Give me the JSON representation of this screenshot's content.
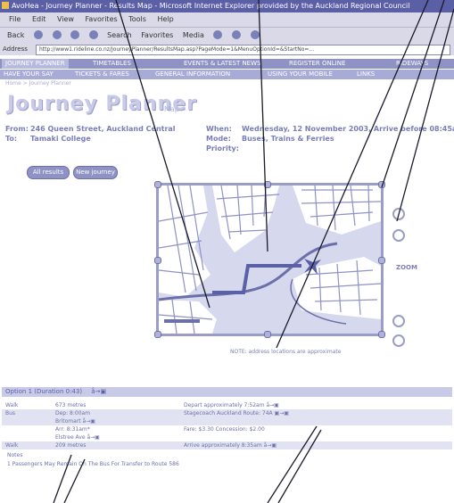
{
  "window": {
    "title": "AvoHea - Journey Planner - Results Map - Microsoft Internet Explorer provided by the Auckland Regional Council",
    "menu": [
      "File",
      "Edit",
      "View",
      "Favorites",
      "Tools",
      "Help"
    ],
    "toolbar": [
      "Back",
      "Search",
      "Favorites",
      "Media"
    ],
    "address_label": "Address",
    "url": "http://www1.rideline.co.nz/JourneyPlanner/ResultsMap.asp?PageMode=1&MenuOptionId=&StartNo=..."
  },
  "nav": {
    "primary": [
      "JOURNEY PLANNER",
      "TIMETABLES",
      "EVENTS & LATEST NEWS",
      "REGISTER ONLINE",
      "RIDEWAYS"
    ],
    "secondary": [
      "HAVE YOUR SAY",
      "TICKETS & FARES",
      "GENERAL INFORMATION",
      "USING YOUR MOBILE",
      "LINKS"
    ],
    "breadcrumb": "Home > Journey Planner"
  },
  "page": {
    "title": "Journey Planner",
    "subtitle": "Map",
    "from_label": "From:",
    "from_value": "246 Queen Street, Auckland Central",
    "to_label": "To:",
    "to_value": "Tamaki College",
    "when_label": "When:",
    "when_value": "Wednesday, 12 November 2003, Arrive before 08:45am",
    "mode_label": "Mode:",
    "mode_value": "Buses, Trains & Ferries",
    "priority_label": "Priority:",
    "all_results_button": "All results",
    "new_journey_button": "New journey",
    "map_note": "NOTE: address locations are approximate",
    "zoom_label": "ZOOM"
  },
  "results": {
    "header": "Option 1 (Duration 0:43)",
    "header_icons": "å→▣",
    "rows": [
      {
        "mode": "Walk",
        "detail": "673 metres",
        "info": "Depart approximately 7:52am å→▣",
        "band": false
      },
      {
        "mode": "Bus",
        "detail": "Dep: 8:00am",
        "info": "Stagecoach Auckland  Route: 74A ▣→▣",
        "band": true
      },
      {
        "mode": "",
        "detail": "Britomart å→▣",
        "info": "",
        "band": true
      },
      {
        "mode": "",
        "detail": "Arr: 8:31am*",
        "info": "Fare: $3.30    Concession: $2.00",
        "band": false
      },
      {
        "mode": "",
        "detail": "Elstree Ave å→▣",
        "info": "",
        "band": false
      },
      {
        "mode": "Walk",
        "detail": "209 metres",
        "info": "Arrive approximately 8:35am å→▣",
        "band": true
      }
    ],
    "notes_label": "Notes",
    "note_1": "1   Passengers May Remain On The Bus For Transfer to Route 586"
  },
  "colors": {
    "accent": "#8e92c4",
    "dark": "#6c70a8",
    "title": "#c8cae8",
    "map_bg": "#d6d8ee"
  }
}
